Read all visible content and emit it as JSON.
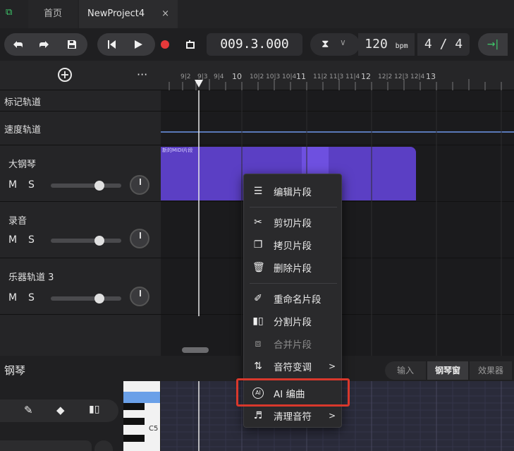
{
  "tabs": {
    "home": "首页",
    "project": "NewProject4",
    "close": "×"
  },
  "toolbar": {
    "position": "009.3.000",
    "bpm": "120",
    "bpm_unit": "bpm",
    "signature": "4 / 4"
  },
  "ruler_ticks": [
    "9|2",
    "9|3",
    "9|4",
    "10",
    "10|2",
    "10|3",
    "10|4",
    "11",
    "11|2",
    "11|3",
    "11|4",
    "12",
    "12|2",
    "12|3",
    "12|4",
    "13"
  ],
  "header": {
    "more": "···"
  },
  "tracks": {
    "marker": "标记轨道",
    "tempo": "速度轨道",
    "t1": "大钢琴",
    "t2": "录音",
    "t3": "乐器轨道 3",
    "m": "M",
    "s": "S"
  },
  "clip": {
    "label": "新的MIDI片段"
  },
  "bottom": {
    "title": "钢琴",
    "tab_input": "输入",
    "tab_piano": "钢琴窗",
    "tab_fx": "效果器",
    "note_label": "C5"
  },
  "menu": {
    "edit": "编辑片段",
    "cut": "剪切片段",
    "copy": "拷贝片段",
    "delete": "删除片段",
    "rename": "重命名片段",
    "split": "分割片段",
    "merge": "合并片段",
    "transpose": "音符变调",
    "ai": "AI 编曲",
    "clean": "清理音符",
    "arrow": ">"
  },
  "colors": {
    "accent": "#3ec96a",
    "clip": "#5b3fc4",
    "highlight": "#d9382c",
    "record": "#e6393a"
  }
}
